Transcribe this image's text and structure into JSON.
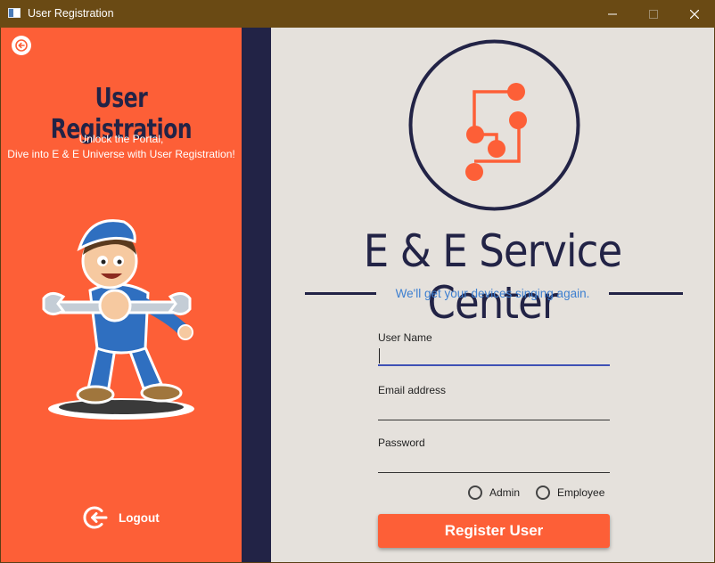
{
  "window": {
    "title": "User Registration",
    "minimize_icon": "minimize-icon",
    "maximize_icon": "maximize-icon",
    "close_icon": "close-icon"
  },
  "sidebar": {
    "back_icon": "arrow-left-circle-icon",
    "title": "User Registration",
    "subtitle_line1": "Unlock the Portal,",
    "subtitle_line2": "Dive into E & E Universe with User Registration!",
    "illustration": "mechanic-boy-with-wrench",
    "logout_icon": "logout-icon",
    "logout_label": "Logout"
  },
  "main": {
    "logo": "circuit-logo",
    "brand_name": "E & E Service Center",
    "tagline": "We'll get your devices singing again.",
    "form": {
      "username_label": "User Name",
      "username_value": "",
      "email_label": "Email address",
      "email_value": "",
      "password_label": "Password",
      "password_value": "",
      "role_options": [
        "Admin",
        "Employee"
      ],
      "role_selected": null,
      "submit_label": "Register User"
    }
  },
  "colors": {
    "accent": "#fd5f37",
    "navy": "#222346",
    "background": "#e5e1dc",
    "titlebar": "#6a4a14",
    "tagline": "#3d7fd0"
  }
}
